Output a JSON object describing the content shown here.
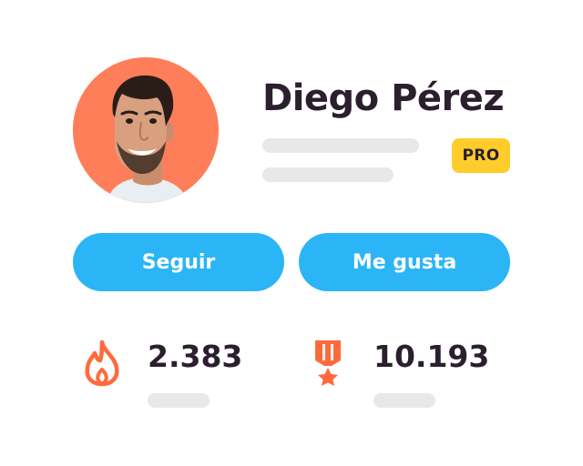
{
  "profile": {
    "name": "Diego Pérez",
    "badge": "PRO",
    "avatar_bg": "#ff7e5a"
  },
  "actions": {
    "follow_label": "Seguir",
    "like_label": "Me gusta",
    "color": "#2bb5f6"
  },
  "stats": [
    {
      "icon": "flame-icon",
      "value": "2.383",
      "color": "#ff6a3d"
    },
    {
      "icon": "medal-icon",
      "value": "10.193",
      "color": "#ff6a3d"
    }
  ]
}
